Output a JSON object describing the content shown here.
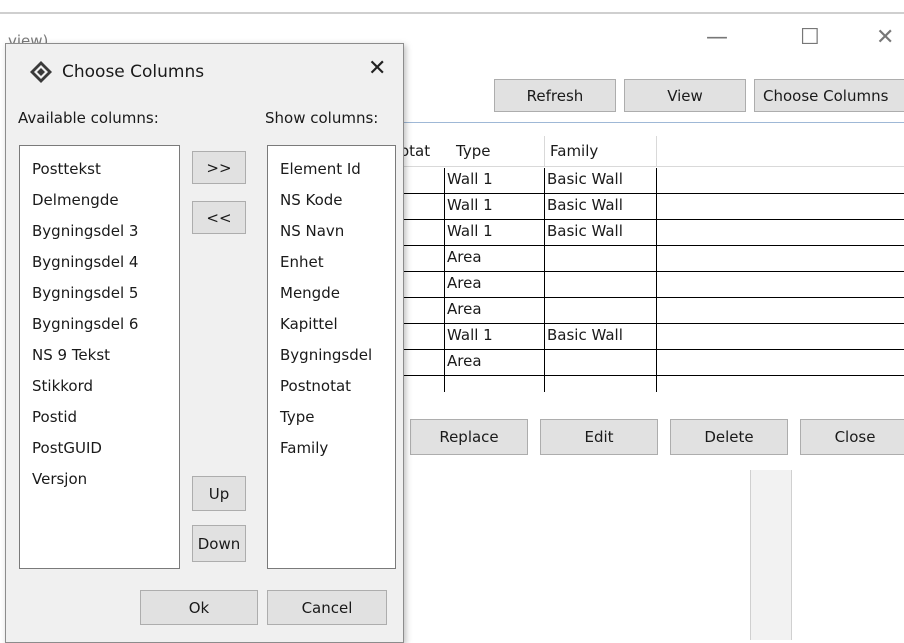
{
  "background_window": {
    "title_fragment": "view)",
    "controls": {
      "minimize": "—",
      "maximize": "☐",
      "close": "✕"
    },
    "toolbar": {
      "refresh": "Refresh",
      "view": "View",
      "choose_columns": "Choose Columns"
    },
    "grid": {
      "columns": [
        "otat",
        "Type",
        "Family"
      ],
      "rows": [
        {
          "type": "Wall 1",
          "family": "Basic Wall"
        },
        {
          "type": "Wall 1",
          "family": "Basic Wall"
        },
        {
          "type": "Wall 1",
          "family": "Basic Wall"
        },
        {
          "type": "Area",
          "family": ""
        },
        {
          "type": "Area",
          "family": ""
        },
        {
          "type": "Area",
          "family": ""
        },
        {
          "type": "Wall 1",
          "family": "Basic Wall"
        },
        {
          "type": "Area",
          "family": ""
        }
      ]
    },
    "bottom_buttons": {
      "replace": "Replace",
      "edit": "Edit",
      "delete": "Delete",
      "close": "Close"
    }
  },
  "dialog": {
    "title": "Choose Columns",
    "close_glyph": "✕",
    "available_label": "Available columns:",
    "show_label": "Show columns:",
    "available_columns": [
      "Posttekst",
      "Delmengde",
      "Bygningsdel 3",
      "Bygningsdel 4",
      "Bygningsdel 5",
      "Bygningsdel 6",
      "NS 9 Tekst",
      "Stikkord",
      "Postid",
      "PostGUID",
      "Versjon"
    ],
    "show_columns": [
      "Element Id",
      "NS Kode",
      "NS Navn",
      "Enhet",
      "Mengde",
      "Kapittel",
      "Bygningsdel",
      "Postnotat",
      "Type",
      "Family"
    ],
    "buttons": {
      "add": ">>",
      "remove": "<<",
      "up": "Up",
      "down": "Down",
      "ok": "Ok",
      "cancel": "Cancel"
    }
  }
}
